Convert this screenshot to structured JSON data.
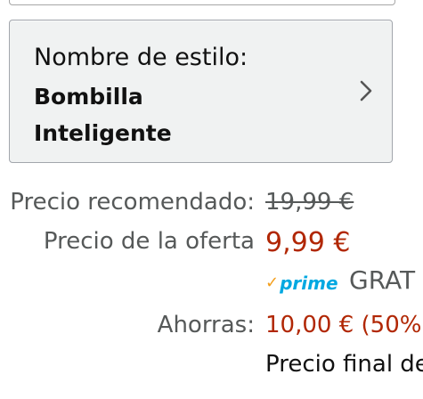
{
  "style_selector": {
    "label": "Nombre de estilo:",
    "value_line1": "Bombilla",
    "value_line2": "Inteligente",
    "chevron_icon": "chevron-right-icon"
  },
  "pricing": {
    "recommended_label": "Precio recomendado:",
    "recommended_value": "19,99 €",
    "offer_label": "Precio de la oferta",
    "offer_value": "9,99 €",
    "prime_check": "✓",
    "prime_word": "prime",
    "shipping": "GRAT",
    "savings_label": "Ahorras:",
    "savings_value": "10,00 € (50%",
    "final_price_text": "Precio final de"
  },
  "colors": {
    "price_red": "#b12704",
    "label_gray": "#565959",
    "prime_blue": "#00a8e1",
    "prime_orange": "#f49f1c",
    "selector_bg": "#f0f2f2"
  }
}
